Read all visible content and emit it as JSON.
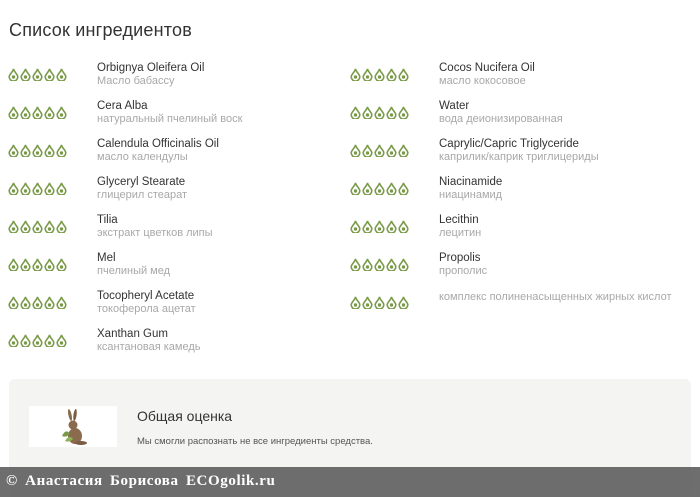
{
  "page_title": "Список ингредиентов",
  "colors": {
    "drop_green": "#7a9a4a",
    "muted_text": "#a8a8a8",
    "card_bg": "#f4f4f3"
  },
  "icons": {
    "rating": "oil-drop-icon",
    "summary": "hare-icon"
  },
  "ingredients_left": [
    {
      "name": "Orbignya Oleifera Oil",
      "ru": "Масло бабассу",
      "drops": 5
    },
    {
      "name": "Cera Alba",
      "ru": "натуральный пчелиный воск",
      "drops": 5
    },
    {
      "name": "Calendula Officinalis Oil",
      "ru": "масло календулы",
      "drops": 5
    },
    {
      "name": "Glyceryl Stearate",
      "ru": "глицерил стеарат",
      "drops": 5
    },
    {
      "name": "Tilia",
      "ru": "экстракт цветков липы",
      "drops": 5
    },
    {
      "name": "Mel",
      "ru": "пчелиный мед",
      "drops": 5
    },
    {
      "name": "Tocopheryl Acetate",
      "ru": "токоферола ацетат",
      "drops": 5
    },
    {
      "name": "Xanthan Gum",
      "ru": "ксантановая камедь",
      "drops": 5
    }
  ],
  "ingredients_right": [
    {
      "name": "Cocos Nucifera Oil",
      "ru": "масло кокосовое",
      "drops": 5
    },
    {
      "name": "Water",
      "ru": "вода деионизированная",
      "drops": 5
    },
    {
      "name": "Caprylic/Capric Triglyceride",
      "ru": "каприлик/каприк триглицериды",
      "drops": 5
    },
    {
      "name": "Niacinamide",
      "ru": "ниацинамид",
      "drops": 5
    },
    {
      "name": "Lecithin",
      "ru": "лецитин",
      "drops": 5
    },
    {
      "name": "Propolis",
      "ru": "прополис",
      "drops": 5
    },
    {
      "name": "",
      "ru": "комплекс полиненасыщенных жирных кислот",
      "drops": 5
    }
  ],
  "summary": {
    "title": "Общая оценка",
    "text": "Мы смогли распознать не все ингредиенты средства."
  },
  "watermark": "© Анастасия Борисова ECOgolik.ru"
}
